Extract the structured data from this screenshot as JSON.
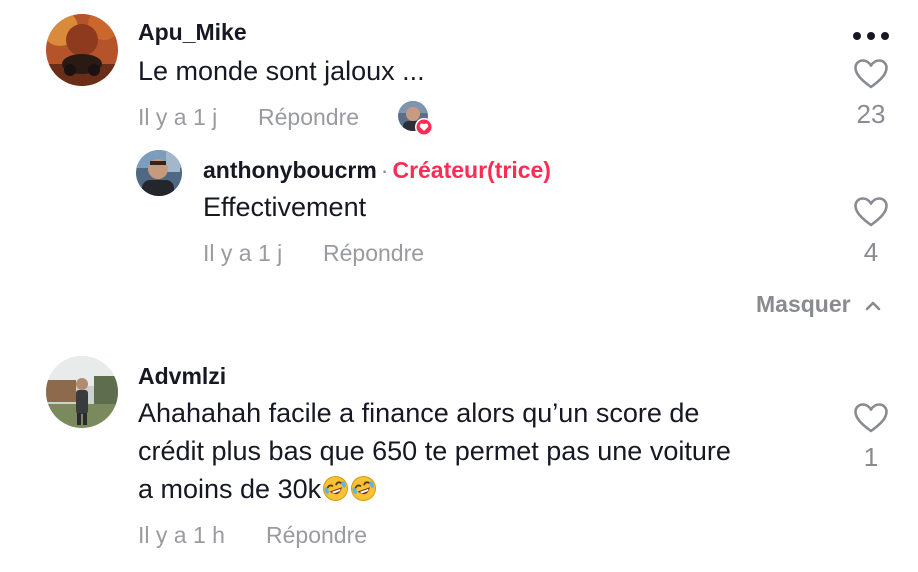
{
  "comments": [
    {
      "username": "Apu_Mike",
      "text": "Le monde sont jaloux ...",
      "time": "Il y a 1 j",
      "reply_label": "Répondre",
      "likes": "23",
      "more_icon": "more-dots-icon"
    },
    {
      "username": "anthonyboucrm",
      "separator": "·",
      "creator_badge": "Créateur(trice)",
      "text": "Effectivement",
      "time": "Il y a 1 j",
      "reply_label": "Répondre",
      "likes": "4"
    },
    {
      "username": "Advmlzi",
      "text_line1": "Ahahahah facile a finance alors qu’un score de",
      "text_line2": "crédit plus bas que 650 te permet pas une voiture",
      "text_line3": "a moins de 30k",
      "time": "Il y a 1 h",
      "reply_label": "Répondre",
      "likes": "1"
    }
  ],
  "masquer_label": "Masquer",
  "icons": {
    "like": "heart-outline-icon",
    "chevron": "chevron-up-icon",
    "creator_liked": "heart-badge-icon",
    "emoji": "rolling-laughing-emoji"
  },
  "colors": {
    "accent": "#fe2c55",
    "muted": "#9a9ba1",
    "text": "#161823"
  }
}
